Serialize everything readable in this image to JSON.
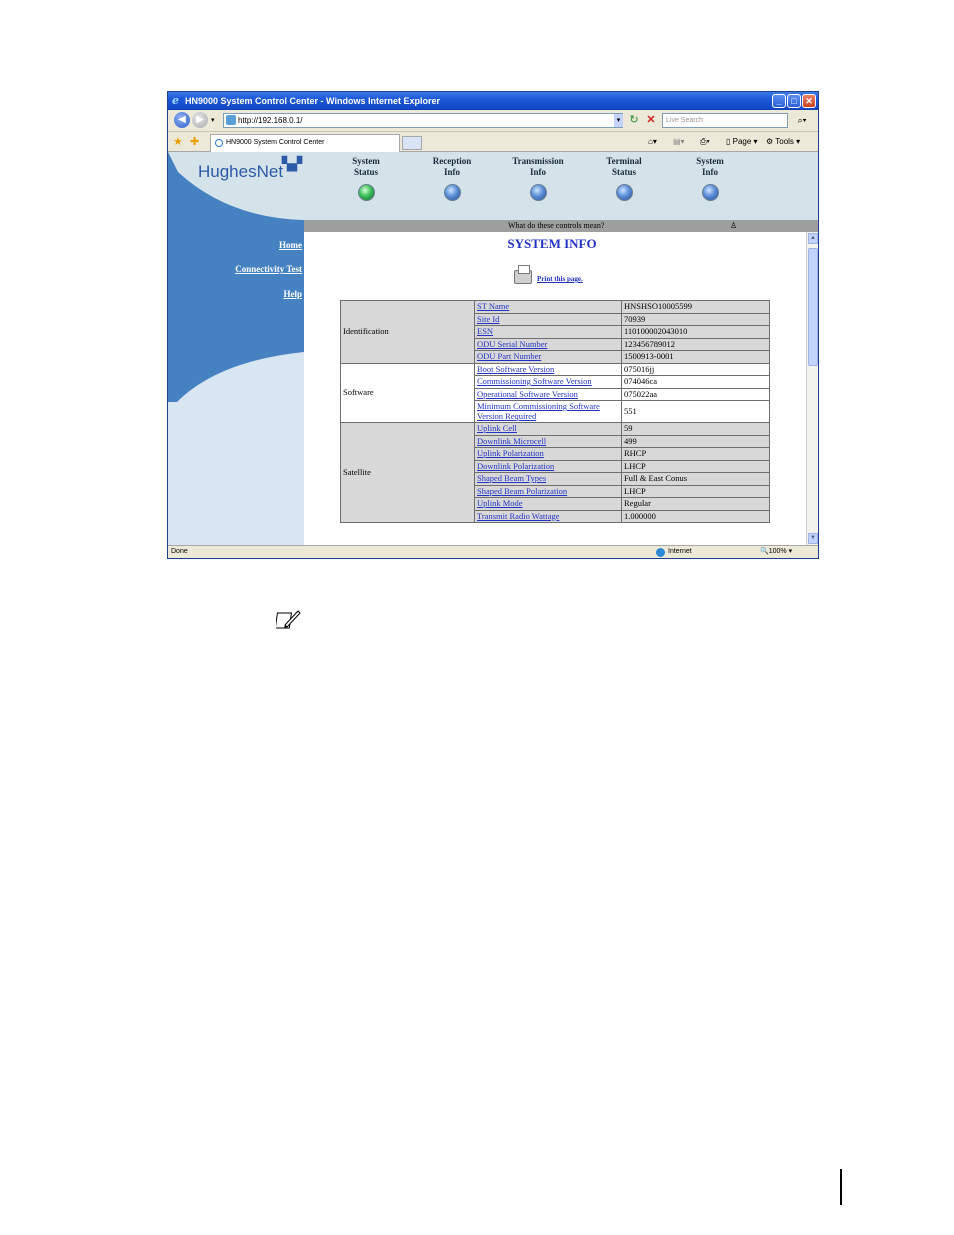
{
  "browser": {
    "title": "HN9000 System Control Center - Windows Internet Explorer",
    "address": "http://192.168.0.1/",
    "search_placeholder": "Live Search",
    "tab_label": "HN9000 System Control Center",
    "toolbar": {
      "page": "Page",
      "tools": "Tools"
    },
    "status": "Done",
    "zone": "Internet",
    "zoom": "100%"
  },
  "site": {
    "logo": "HughesNet",
    "nav_status": [
      {
        "line1": "System",
        "line2": "Status",
        "state": "green"
      },
      {
        "line1": "Reception",
        "line2": "Info",
        "state": "blue"
      },
      {
        "line1": "Transmission",
        "line2": "Info",
        "state": "blue"
      },
      {
        "line1": "Terminal",
        "line2": "Status",
        "state": "blue"
      },
      {
        "line1": "System",
        "line2": "Info",
        "state": "blue"
      }
    ],
    "controls_question": "What do these controls mean?",
    "side_links": [
      "Home",
      "Connectivity Test",
      "Help"
    ],
    "page_title": "SYSTEM INFO",
    "print_link": "Print this page."
  },
  "table": {
    "groups": [
      {
        "name": "Identification",
        "rows": [
          {
            "label": "ST Name",
            "value": "HNSHSO10005599"
          },
          {
            "label": "Site Id",
            "value": "70939"
          },
          {
            "label": "ESN",
            "value": "110100002043010"
          },
          {
            "label": "ODU Serial Number",
            "value": "123456789012"
          },
          {
            "label": "ODU Part Number",
            "value": "1500913-0001"
          }
        ]
      },
      {
        "name": "Software",
        "rows": [
          {
            "label": "Boot Software Version",
            "value": "075016jj"
          },
          {
            "label": "Commissioning Software Version",
            "value": "074046ca"
          },
          {
            "label": "Operational Software Version",
            "value": "075022aa"
          },
          {
            "label": "Minimum Commissioning Software Version Required",
            "value": "551"
          }
        ]
      },
      {
        "name": "Satellite",
        "rows": [
          {
            "label": "Uplink Cell",
            "value": "59"
          },
          {
            "label": "Downlink Microcell",
            "value": "499"
          },
          {
            "label": "Uplink Polarization",
            "value": "RHCP"
          },
          {
            "label": "Downlink Polarization",
            "value": "LHCP"
          },
          {
            "label": "Shaped Beam Types",
            "value": "Full & East Conus"
          },
          {
            "label": "Shaped Beam Polarization",
            "value": "LHCP"
          },
          {
            "label": "Uplink Mode",
            "value": "Regular"
          },
          {
            "label": "Transmit Radio Wattage",
            "value": "1.000000"
          }
        ]
      }
    ]
  },
  "colors": {
    "sidebar": "#4682c1",
    "link": "#2233c4",
    "header_bg": "#d4e2ea"
  }
}
